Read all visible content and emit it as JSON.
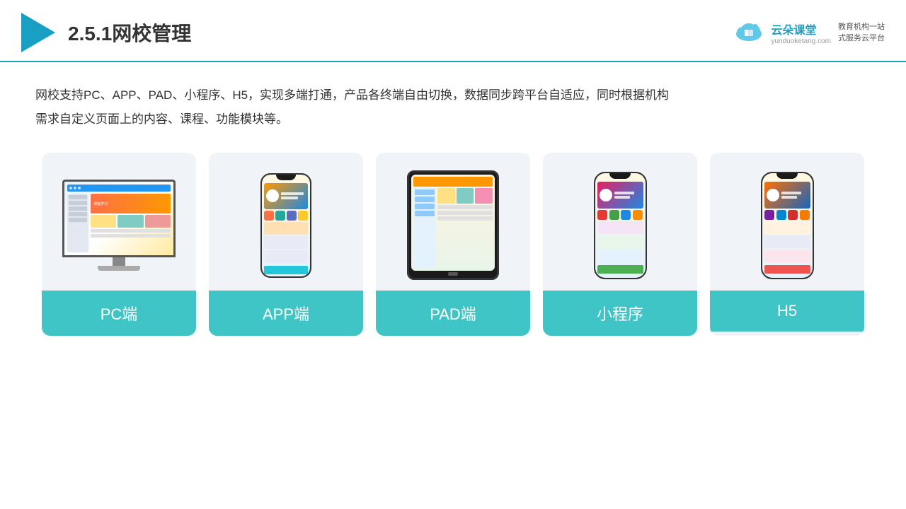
{
  "header": {
    "title": "2.5.1网校管理",
    "brand_name": "云朵课堂",
    "brand_url": "yunduoketang.com",
    "brand_slogan": "教育机构一站\n式服务云平台"
  },
  "description": "网校支持PC、APP、PAD、小程序、H5，实现多端打通，产品各终端自由切换，数据同步跨平台自适应，同时根据机构\n需求自定义页面上的内容、课程、功能模块等。",
  "cards": [
    {
      "id": "pc",
      "label": "PC端"
    },
    {
      "id": "app",
      "label": "APP端"
    },
    {
      "id": "pad",
      "label": "PAD端"
    },
    {
      "id": "miniapp",
      "label": "小程序"
    },
    {
      "id": "h5",
      "label": "H5"
    }
  ]
}
